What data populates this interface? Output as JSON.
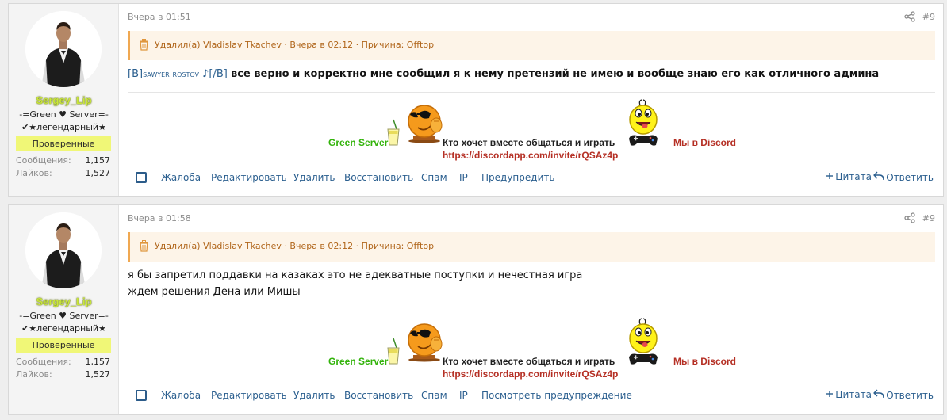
{
  "posts": [
    {
      "user": {
        "name": "Sergey_Lip",
        "title_line1": "-=Green ♥ Server=-",
        "title_line2": "✔★легендарный★",
        "banner": "Проверенные",
        "stats": [
          {
            "label": "Сообщения:",
            "value": "1,157"
          },
          {
            "label": "Лайков:",
            "value": "1,527"
          }
        ]
      },
      "date": "Вчера в 01:51",
      "post_number": "#9",
      "deleted_notice": "Удалил(а) Vladislav Tkachev · Вчера в 02:12 · Причина: Offtop",
      "message": {
        "prefix_open": "[B]",
        "prefix_name": "sawyer rostov",
        "prefix_note": " ♪[/B] ",
        "bold_text": "все верно и корректно мне сообщил я к нему претензий не имею и вообще знаю его как отличного админа"
      },
      "signature": {
        "green_server": "Green Server",
        "invite_text": "Кто хочет вместе общаться и играть",
        "invite_link": "https://discordapp.com/invite/rQSAz4p",
        "discord_label": "Мы в Discord"
      },
      "actions": [
        "Жалоба",
        "Редактировать",
        "Удалить",
        "Восстановить",
        "Спам",
        "IP",
        "Предупредить"
      ],
      "quote_label": "Цитата",
      "reply_label": "Ответить"
    },
    {
      "user": {
        "name": "Sergey_Lip",
        "title_line1": "-=Green ♥ Server=-",
        "title_line2": "✔★легендарный★",
        "banner": "Проверенные",
        "stats": [
          {
            "label": "Сообщения:",
            "value": "1,157"
          },
          {
            "label": "Лайков:",
            "value": "1,527"
          }
        ]
      },
      "date": "Вчера в 01:58",
      "post_number": "#9",
      "deleted_notice": "Удалил(а) Vladislav Tkachev · Вчера в 02:12 · Причина: Offtop",
      "message_lines": [
        "я бы запретил поддавки на казаках это не адекватные поступки и нечестная игра",
        "ждем решения Дена или Мишы"
      ],
      "signature": {
        "green_server": "Green Server",
        "invite_text": "Кто хочет вместе общаться и играть",
        "invite_link": "https://discordapp.com/invite/rQSAz4p",
        "discord_label": "Мы в Discord"
      },
      "actions": [
        "Жалоба",
        "Редактировать",
        "Удалить",
        "Восстановить",
        "Спам",
        "IP",
        "Посмотреть предупреждение"
      ],
      "quote_label": "Цитата",
      "reply_label": "Ответить"
    }
  ]
}
